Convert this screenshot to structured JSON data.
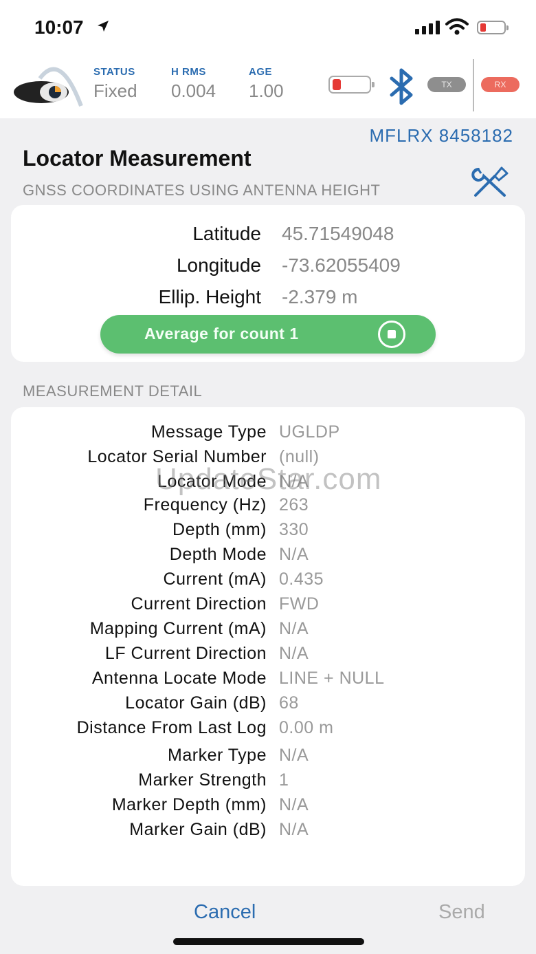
{
  "status_bar": {
    "time": "10:07"
  },
  "header": {
    "columns": [
      {
        "label": "STATUS",
        "value": "Fixed"
      },
      {
        "label": "H RMS",
        "value": "0.004"
      },
      {
        "label": "AGE",
        "value": "1.00"
      }
    ],
    "tx_label": "TX",
    "rx_label": "RX",
    "device_battery_level": 0.15,
    "phone_battery_level": 0.2
  },
  "page": {
    "device_id": "MFLRX 8458182",
    "title": "Locator Measurement",
    "subtitle": "GNSS COORDINATES USING ANTENNA HEIGHT"
  },
  "coordinates": {
    "rows": [
      {
        "label": "Latitude",
        "value": "45.71549048"
      },
      {
        "label": "Longitude",
        "value": "-73.62055409"
      },
      {
        "label": "Ellip. Height",
        "value": "-2.379 m"
      }
    ],
    "average_button": "Average for count 1"
  },
  "detail": {
    "section_label": "MEASUREMENT DETAIL",
    "rows": [
      {
        "label": "Message Type",
        "value": "UGLDP"
      },
      {
        "label": "Locator Serial Number",
        "value": "(null)"
      },
      {
        "label": "Locator Mode",
        "value": "N/A"
      },
      {
        "label": "Frequency (Hz)",
        "value": "263"
      },
      {
        "label": "Depth (mm)",
        "value": "330"
      },
      {
        "label": "Depth Mode",
        "value": "N/A"
      },
      {
        "label": "Current (mA)",
        "value": "0.435"
      },
      {
        "label": "Current Direction",
        "value": "FWD"
      },
      {
        "label": "Mapping Current  (mA)",
        "value": "N/A"
      },
      {
        "label": "LF Current Direction",
        "value": "N/A"
      },
      {
        "label": "Antenna Locate Mode",
        "value": "LINE + NULL"
      },
      {
        "label": "Locator Gain (dB)",
        "value": "68"
      },
      {
        "label": "Distance From Last Log",
        "value": "0.00 m"
      },
      {
        "label": "Marker Type",
        "value": "N/A"
      },
      {
        "label": "Marker Strength",
        "value": "1"
      },
      {
        "label": "Marker Depth (mm)",
        "value": "N/A"
      },
      {
        "label": "Marker Gain (dB)",
        "value": "N/A"
      }
    ]
  },
  "watermark": "UpdateStar.com",
  "footer": {
    "cancel": "Cancel",
    "send": "Send"
  },
  "colors": {
    "accent": "#2b6cb0",
    "button_green": "#5cbf70",
    "rx_red": "#ec6b5e",
    "battery_low": "#e53935"
  }
}
